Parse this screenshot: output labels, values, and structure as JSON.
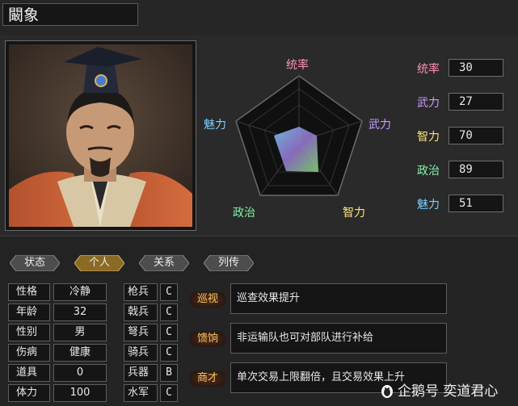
{
  "character": {
    "name": "闞象"
  },
  "radar": {
    "labels": {
      "top": "统率",
      "right": "武力",
      "bottom_right": "智力",
      "bottom_left": "政治",
      "left": "魅力"
    },
    "colors": {
      "top": "#ff8fb0",
      "right": "#c69cff",
      "bottom_right": "#ffe27a",
      "bottom_left": "#84f0a8",
      "left": "#7ad0ff"
    }
  },
  "stats": [
    {
      "label": "统率",
      "value": "30",
      "color": "#ff8fb0"
    },
    {
      "label": "武力",
      "value": "27",
      "color": "#c69cff"
    },
    {
      "label": "智力",
      "value": "70",
      "color": "#ffe27a"
    },
    {
      "label": "政治",
      "value": "89",
      "color": "#84f0a8"
    },
    {
      "label": "魅力",
      "value": "51",
      "color": "#7ad0ff"
    }
  ],
  "tabs": [
    {
      "label": "状态",
      "active": false
    },
    {
      "label": "个人",
      "active": true
    },
    {
      "label": "关系",
      "active": false
    },
    {
      "label": "列传",
      "active": false
    }
  ],
  "profile": [
    {
      "label": "性格",
      "value": "冷静"
    },
    {
      "label": "年龄",
      "value": "32"
    },
    {
      "label": "性别",
      "value": "男"
    },
    {
      "label": "伤病",
      "value": "健康"
    },
    {
      "label": "道具",
      "value": "0"
    },
    {
      "label": "体力",
      "value": "100"
    }
  ],
  "aptitudes": [
    {
      "label": "枪兵",
      "grade": "C"
    },
    {
      "label": "戟兵",
      "grade": "C"
    },
    {
      "label": "弩兵",
      "grade": "C"
    },
    {
      "label": "骑兵",
      "grade": "C"
    },
    {
      "label": "兵器",
      "grade": "B"
    },
    {
      "label": "水军",
      "grade": "C"
    }
  ],
  "skills": [
    {
      "name": "巡视",
      "desc": "巡查效果提升"
    },
    {
      "name": "馈饷",
      "desc": "非运输队也可对部队进行补给"
    },
    {
      "name": "商才",
      "desc": "单次交易上限翻倍，且交易效果上升"
    }
  ],
  "watermark": "企鹅号 奕道君心",
  "icons": {
    "watermark": "penguin-icon"
  }
}
